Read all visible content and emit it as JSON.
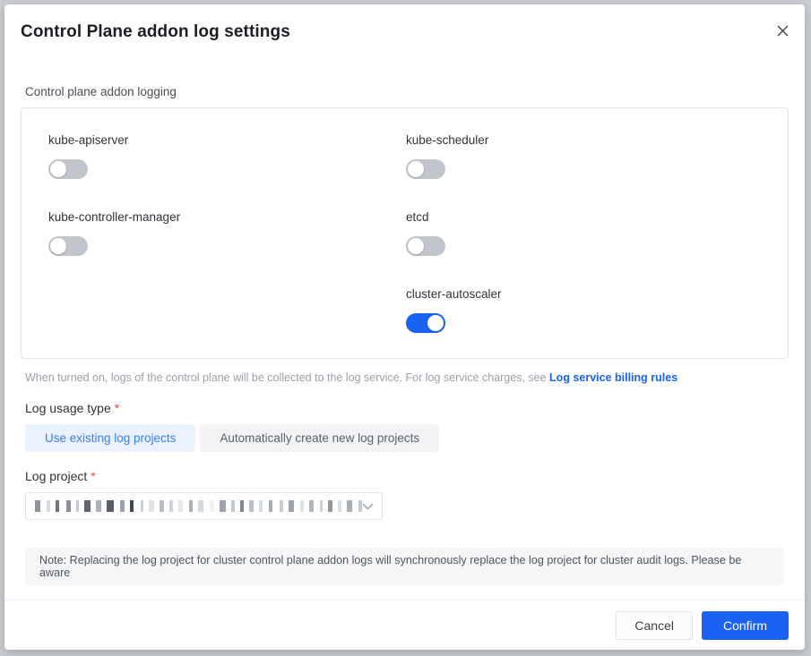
{
  "dialog": {
    "title": "Control Plane addon log settings",
    "close_icon": "close-icon"
  },
  "logging_section": {
    "label": "Control plane addon logging",
    "toggles_left": [
      {
        "label": "kube-apiserver",
        "on": false
      },
      {
        "label": "kube-controller-manager",
        "on": false
      }
    ],
    "toggles_right": [
      {
        "label": "kube-scheduler",
        "on": false
      },
      {
        "label": "etcd",
        "on": false
      },
      {
        "label": "cluster-autoscaler",
        "on": true
      }
    ],
    "hint_text": "When turned on, logs of the control plane will be collected to the log service. For log service charges, see",
    "hint_link": "Log service billing rules"
  },
  "log_usage_type": {
    "label": "Log usage type",
    "required_mark": "*",
    "options": [
      {
        "label": "Use existing log projects",
        "selected": true
      },
      {
        "label": "Automatically create new log projects",
        "selected": false
      }
    ]
  },
  "log_project": {
    "label": "Log project",
    "required_mark": "*",
    "value": "",
    "value_redacted": true,
    "chevron_icon": "chevron-down-icon",
    "chevron_glyph": "⌄"
  },
  "note": {
    "text": "Note: Replacing the log project for cluster control plane addon logs will synchronously replace the log project for cluster audit logs. Please be aware"
  },
  "footer": {
    "cancel_label": "Cancel",
    "confirm_label": "Confirm"
  },
  "colors": {
    "accent": "#1a62f2",
    "toggle_off": "#c2c6cc",
    "link": "#1a62f2",
    "required": "#e34d4d",
    "seg_active_bg": "#e9f2fe",
    "note_bg": "#f5f6f8"
  }
}
